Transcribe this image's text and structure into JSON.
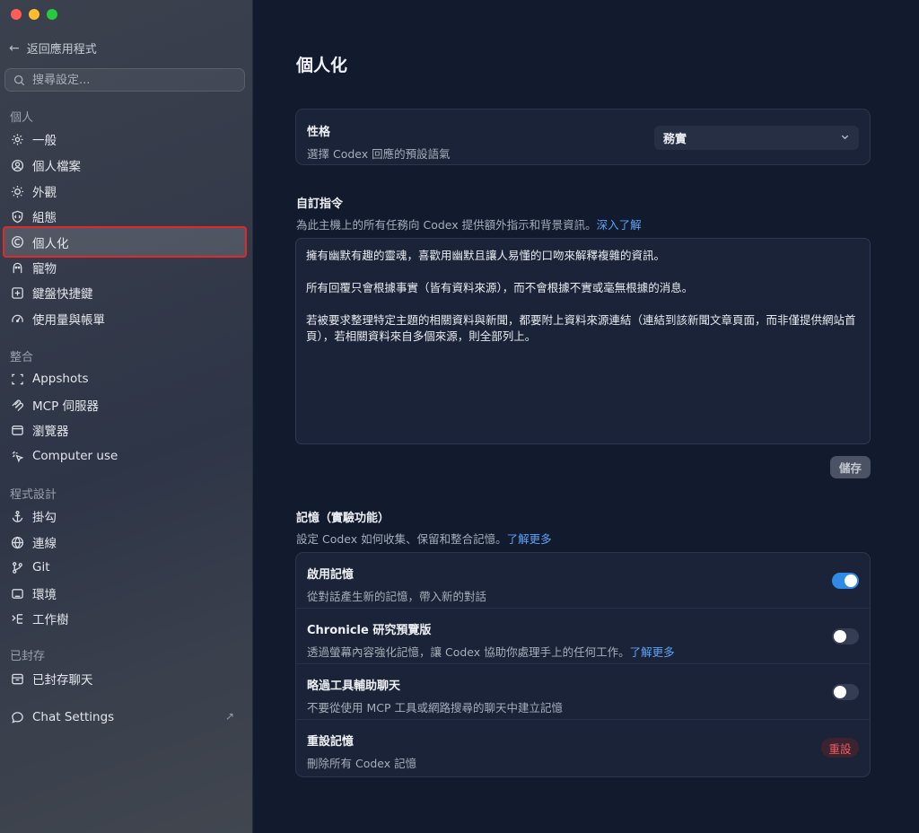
{
  "sidebar": {
    "back_label": "返回應用程式",
    "search_placeholder": "搜尋設定...",
    "sections": {
      "personal": "個人",
      "integration": "整合",
      "programming": "程式設計",
      "archived": "已封存"
    },
    "items": {
      "general": "一般",
      "profile": "個人檔案",
      "appearance": "外觀",
      "configuration": "組態",
      "personalization": "個人化",
      "pets": "寵物",
      "shortcuts": "鍵盤快捷鍵",
      "usage": "使用量與帳單",
      "appshots": "Appshots",
      "mcp": "MCP 伺服器",
      "browser": "瀏覽器",
      "computer_use": "Computer use",
      "hooks": "掛勾",
      "connections": "連線",
      "git": "Git",
      "environment": "環境",
      "worktree": "工作樹",
      "archived_chats": "已封存聊天",
      "chat_settings": "Chat Settings"
    }
  },
  "main": {
    "title": "個人化",
    "personality": {
      "title": "性格",
      "desc": "選擇 Codex 回應的預設語氣",
      "selected": "務實"
    },
    "custom": {
      "title": "自訂指令",
      "desc": "為此主機上的所有任務向 Codex 提供額外指示和背景資訊。",
      "link": "深入了解",
      "text": "擁有幽默有趣的靈魂，喜歡用幽默且讓人易懂的口吻來解釋複雜的資訊。\n\n所有回覆只會根據事實（皆有資料來源），而不會根據不實或毫無根據的消息。\n\n若被要求整理特定主題的相關資料與新聞，都要附上資料來源連結（連結到該新聞文章頁面，而非僅提供網站首頁），若相關資料來自多個來源，則全部列上。",
      "save": "儲存"
    },
    "memory": {
      "title": "記憶（實驗功能）",
      "desc": "設定 Codex 如何收集、保留和整合記憶。",
      "link": "了解更多",
      "rows": [
        {
          "title": "啟用記憶",
          "desc": "從對話產生新的記憶，帶入新的對話",
          "enabled": true
        },
        {
          "title": "Chronicle 研究預覽版",
          "desc": "透過螢幕內容強化記憶，讓 Codex 協助你處理手上的任何工作。",
          "link": "了解更多",
          "enabled": false
        },
        {
          "title": "略過工具輔助聊天",
          "desc": "不要從使用 MCP 工具或網路搜尋的聊天中建立記憶",
          "enabled": false
        },
        {
          "title": "重設記憶",
          "desc": "刪除所有 Codex 記憶",
          "button": "重設"
        }
      ]
    }
  },
  "colors": {
    "accent": "#2f8ae6",
    "link": "#5ea2f4",
    "danger": "#ef5b60",
    "highlight_outline": "#e02a2a"
  }
}
